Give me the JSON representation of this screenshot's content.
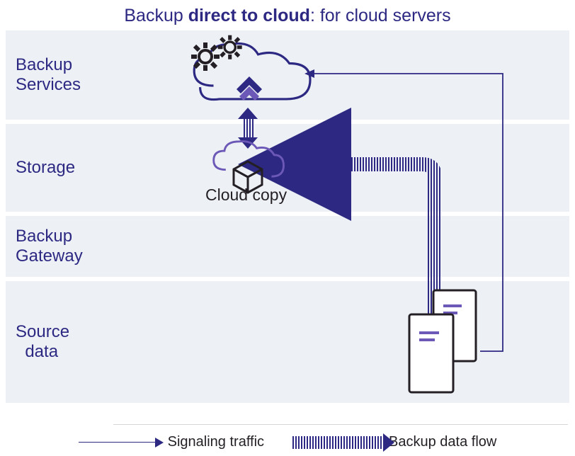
{
  "title_prefix": "Backup ",
  "title_bold": "direct to cloud",
  "title_suffix": ": for cloud servers",
  "rows": {
    "services": "Backup\nServices",
    "storage": "Storage",
    "gateway": "Backup\nGateway",
    "source": "Source\n  data"
  },
  "labels": {
    "cloud_copy": "Cloud copy"
  },
  "legend": {
    "signaling": "Signaling traffic",
    "dataflow": "Backup data flow"
  },
  "icons": {
    "gears": "gears-icon",
    "services_cloud": "cloud-icon",
    "storage_cloud": "cloud-icon",
    "cube": "cube-icon",
    "server1": "server-icon",
    "server2": "server-icon"
  },
  "colors": {
    "primary": "#2d2983",
    "primary_light": "#6c58b7",
    "panel": "#edf1f5",
    "text_dark": "#231f24"
  }
}
